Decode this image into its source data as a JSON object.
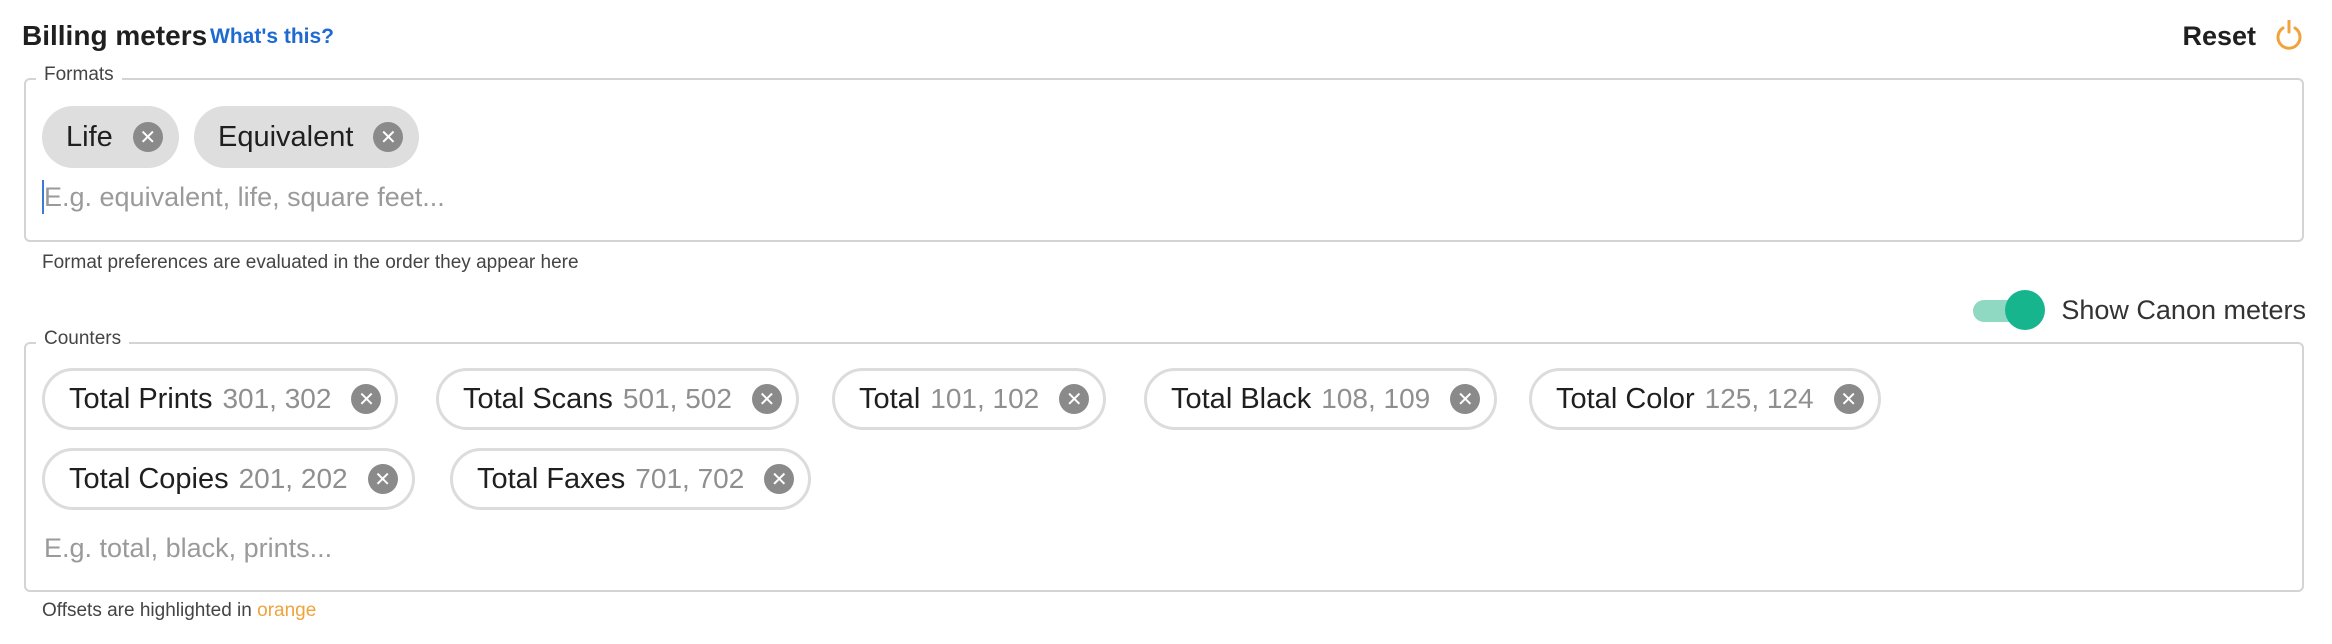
{
  "header": {
    "title": "Billing meters",
    "whats_this": "What's this?",
    "reset_label": "Reset",
    "reset_icon": "refresh-icon",
    "accent_color": "#f0a33a"
  },
  "formats": {
    "legend": "Formats",
    "chips": [
      {
        "label": "Life"
      },
      {
        "label": "Equivalent"
      }
    ],
    "placeholder": "E.g. equivalent, life, square feet...",
    "helper": "Format preferences are evaluated in the order they appear here"
  },
  "toggle": {
    "label": "Show Canon meters",
    "on": true,
    "color": "#16b58e"
  },
  "counters": {
    "legend": "Counters",
    "chips": [
      {
        "name": "Total Prints",
        "codes": "301, 302"
      },
      {
        "name": "Total Scans",
        "codes": "501, 502"
      },
      {
        "name": "Total",
        "codes": "101, 102"
      },
      {
        "name": "Total Black",
        "codes": "108, 109"
      },
      {
        "name": "Total Color",
        "codes": "125, 124"
      },
      {
        "name": "Total Copies",
        "codes": "201, 202"
      },
      {
        "name": "Total Faxes",
        "codes": "701, 702"
      }
    ],
    "placeholder": "E.g. total, black, prints...",
    "helper_prefix": "Offsets are highlighted in",
    "helper_highlight": "orange"
  }
}
